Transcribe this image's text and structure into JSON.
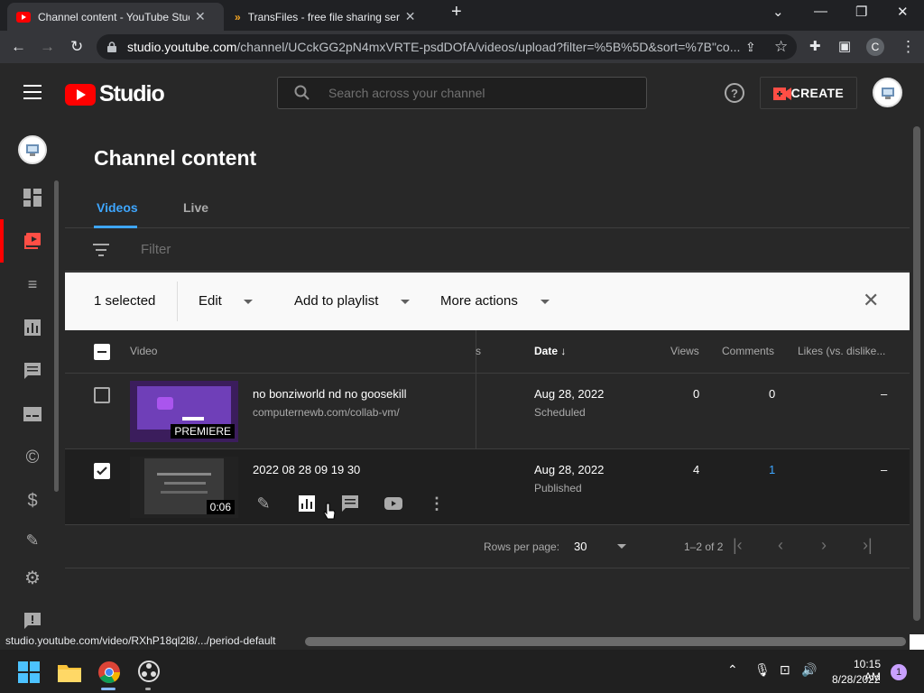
{
  "browser": {
    "tabs": [
      {
        "title": "Channel content - YouTube Studio",
        "active": true
      },
      {
        "title": "TransFiles - free file sharing service",
        "active": false
      }
    ],
    "url_host": "studio.youtube.com",
    "url_path": "/channel/UCckGG2pN4mxVRTE-psdDOfA/videos/upload?filter=%5B%5D&sort=%7B\"co...",
    "profile_initial": "C"
  },
  "header": {
    "logo_text": "Studio",
    "search_placeholder": "Search across your channel",
    "create_label": "CREATE"
  },
  "page": {
    "title": "Channel content",
    "tabs": [
      "Videos",
      "Live"
    ],
    "filter_placeholder": "Filter"
  },
  "selection_bar": {
    "count_label": "1 selected",
    "edit_label": "Edit",
    "playlist_label": "Add to playlist",
    "more_label": "More actions"
  },
  "table": {
    "headers": {
      "video": "Video",
      "hidden_col": "s",
      "date": "Date",
      "views": "Views",
      "comments": "Comments",
      "likes": "Likes (vs. dislike..."
    },
    "rows": [
      {
        "checked": false,
        "title": "no bonziworld nd no goosekill",
        "desc": "computernewb.com/collab-vm/",
        "thumb_badge": "PREMIERE",
        "date": "Aug 28, 2022",
        "status": "Scheduled",
        "views": "0",
        "comments": "0",
        "likes": "–"
      },
      {
        "checked": true,
        "title": "2022 08 28 09 19 30",
        "desc": "",
        "thumb_badge": "0:06",
        "date": "Aug 28, 2022",
        "status": "Published",
        "views": "4",
        "comments": "1",
        "likes": "–"
      }
    ]
  },
  "pagination": {
    "rows_per_page_label": "Rows per page:",
    "rows_per_page_value": "30",
    "range_label": "1–2 of 2"
  },
  "status_bar": {
    "url": "studio.youtube.com/video/RXhP18ql2l8/.../period-default"
  },
  "taskbar": {
    "time": "10:15 AM",
    "date": "8/28/2022",
    "notification_count": "1"
  },
  "colors": {
    "accent_blue": "#3ea6ff",
    "youtube_red": "#ff0000"
  }
}
